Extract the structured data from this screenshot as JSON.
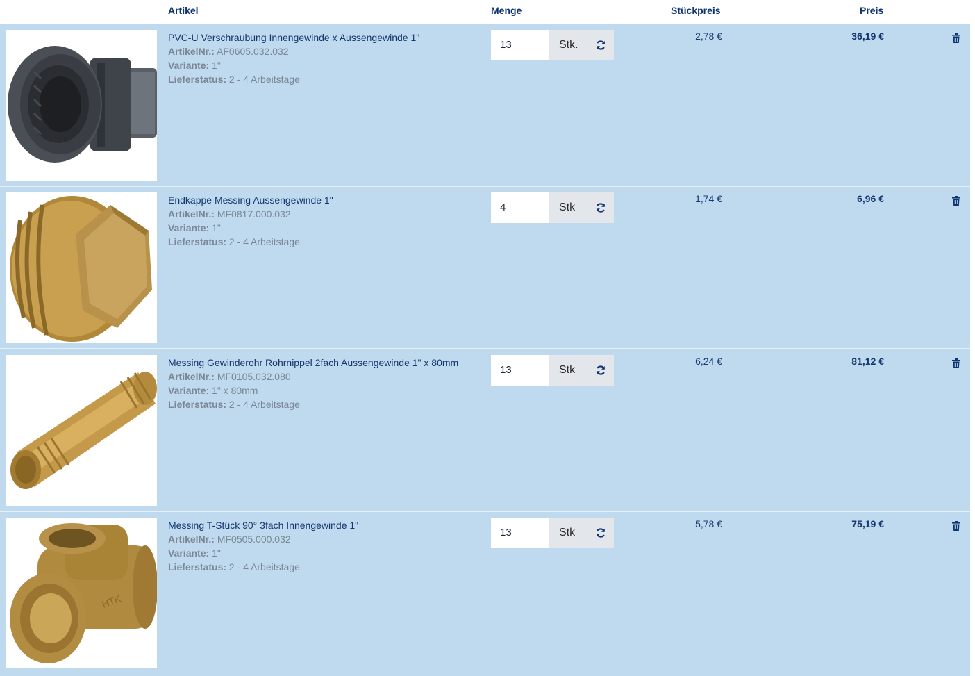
{
  "table": {
    "headers": {
      "artikel": "Artikel",
      "menge": "Menge",
      "stueckpreis": "Stückpreis",
      "preis": "Preis"
    },
    "labels": {
      "artikelnr": "ArtikelNr.:",
      "variante": "Variante:",
      "lieferstatus": "Lieferstatus:"
    },
    "items": [
      {
        "title": "PVC-U Verschraubung Innengewinde x Aussengewinde 1\"",
        "artikelnr": "AF0605.032.032",
        "variante": "1\"",
        "lieferstatus": "2 - 4 Arbeitstage",
        "quantity": "13",
        "unit": "Stk.",
        "unit_price": "2,78 €",
        "total": "36,19 €",
        "image_icon": "pvc-union-fitting-image"
      },
      {
        "title": "Endkappe Messing Aussengewinde 1\"",
        "artikelnr": "MF0817.000.032",
        "variante": "1\"",
        "lieferstatus": "2 - 4 Arbeitstage",
        "quantity": "4",
        "unit": "Stk",
        "unit_price": "1,74 €",
        "total": "6,96 €",
        "image_icon": "brass-end-cap-image"
      },
      {
        "title": "Messing Gewinderohr Rohrnippel 2fach Aussengewinde 1\" x 80mm",
        "artikelnr": "MF0105.032.080",
        "variante": "1\" x 80mm",
        "lieferstatus": "2 - 4 Arbeitstage",
        "quantity": "13",
        "unit": "Stk",
        "unit_price": "6,24 €",
        "total": "81,12 €",
        "image_icon": "brass-pipe-nipple-image"
      },
      {
        "title": "Messing T-Stück 90° 3fach Innengewinde 1\"",
        "artikelnr": "MF0505.000.032",
        "variante": "1\"",
        "lieferstatus": "2 - 4 Arbeitstage",
        "quantity": "13",
        "unit": "Stk",
        "unit_price": "5,78 €",
        "total": "75,19 €",
        "image_icon": "brass-tee-fitting-image"
      }
    ]
  },
  "icons": {
    "refresh": "refresh-icon",
    "delete": "trash-icon"
  },
  "colors": {
    "row_background": "#bfdaef",
    "heading_text": "#0f3470",
    "meta_text": "#7b8794",
    "unit_button": "#e3e7ec"
  }
}
